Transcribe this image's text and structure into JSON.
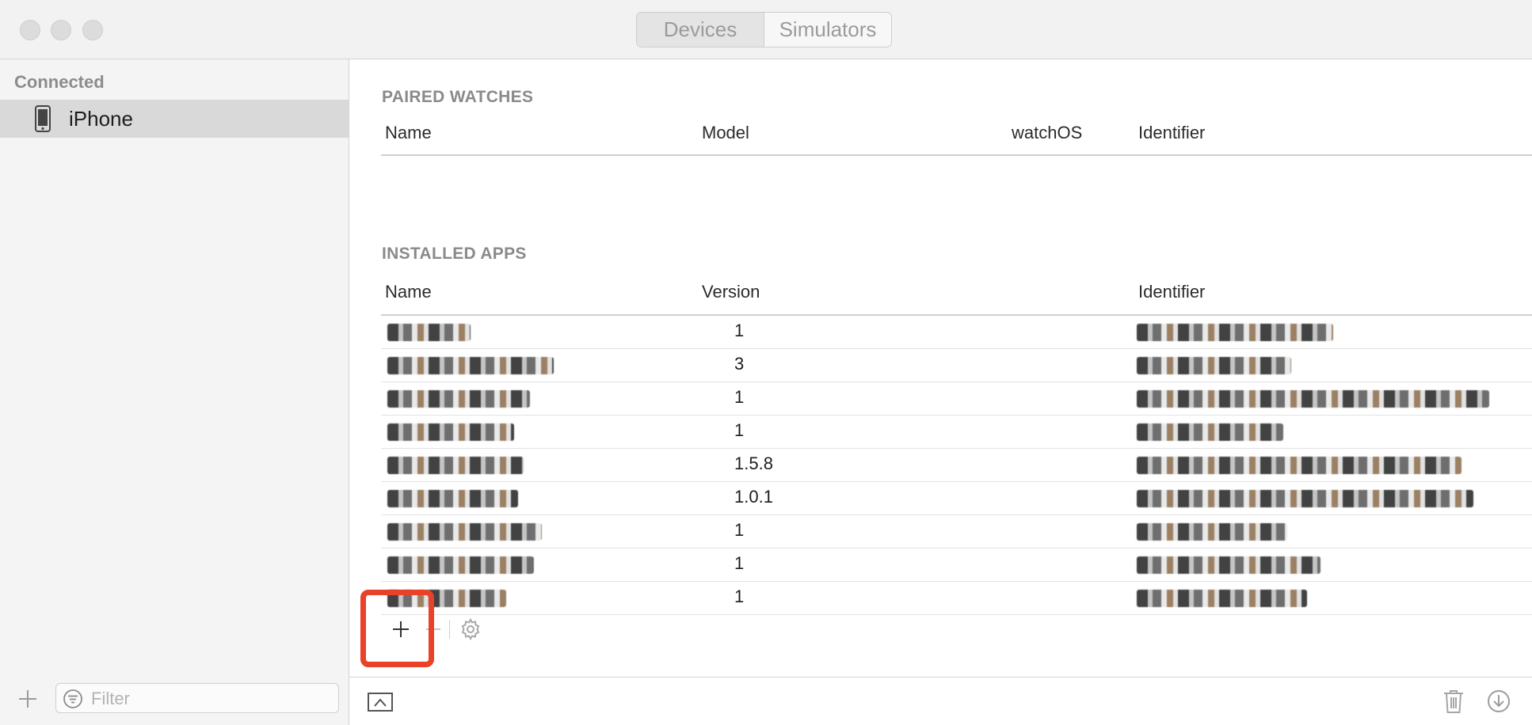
{
  "window": {
    "tabs": [
      {
        "label": "Devices",
        "active": true
      },
      {
        "label": "Simulators",
        "active": false
      }
    ]
  },
  "sidebar": {
    "section_label": "Connected",
    "items": [
      {
        "label": "iPhone",
        "icon": "iphone-icon",
        "selected": true
      }
    ],
    "filter_placeholder": "Filter"
  },
  "paired_watches": {
    "title": "PAIRED WATCHES",
    "columns": [
      "Name",
      "Model",
      "watchOS",
      "Identifier"
    ],
    "rows": []
  },
  "installed_apps": {
    "title": "INSTALLED APPS",
    "columns": [
      "Name",
      "Version",
      "Identifier"
    ],
    "rows": [
      {
        "version": "1"
      },
      {
        "version": "3"
      },
      {
        "version": "1"
      },
      {
        "version": "1"
      },
      {
        "version": "1.5.8"
      },
      {
        "version": "1.0.1"
      },
      {
        "version": "1"
      },
      {
        "version": "1"
      },
      {
        "version": "1"
      }
    ],
    "tools": [
      "plus-icon",
      "minus-icon",
      "gear-icon"
    ]
  },
  "bottom_bar": {
    "icons": [
      "screenshot-icon",
      "trash-icon",
      "download-icon"
    ]
  },
  "colors": {
    "highlight": "#ea4129",
    "selection": "#d9d9d9",
    "sidebar_bg": "#f4f4f4"
  }
}
